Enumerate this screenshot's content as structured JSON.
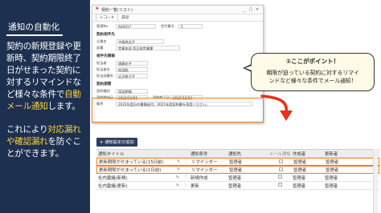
{
  "left_panel": {
    "title": "通知の自動化",
    "p1_lines": [
      {
        "parts": [
          {
            "text": "契約の新規登録や更",
            "hl": false
          }
        ]
      },
      {
        "parts": [
          {
            "text": "新時、契約期限終了",
            "hl": false
          }
        ]
      },
      {
        "parts": [
          {
            "text": "日がせまった契約に",
            "hl": false
          }
        ]
      },
      {
        "parts": [
          {
            "text": "対するリマインドな",
            "hl": false
          }
        ]
      },
      {
        "parts": [
          {
            "text": "ど様々な条件で",
            "hl": false
          },
          {
            "text": "自動",
            "hl": true
          }
        ]
      },
      {
        "parts": [
          {
            "text": "メール通知",
            "hl": true
          },
          {
            "text": "します。",
            "hl": false
          }
        ]
      }
    ],
    "p2_lines": [
      {
        "parts": [
          {
            "text": "これにより",
            "hl": false
          },
          {
            "text": "対応漏れ",
            "hl": true
          }
        ]
      },
      {
        "parts": [
          {
            "text": "や確認漏れ",
            "hl": true
          },
          {
            "text": "を防ぐこ",
            "hl": false
          }
        ]
      },
      {
        "parts": [
          {
            "text": "とができます。",
            "hl": false
          }
        ]
      }
    ],
    "highlight_color": "#ffd23c"
  },
  "record_window": {
    "title": "契約一覧(リスト)",
    "controls": [
      "_",
      "□",
      "×"
    ],
    "tabs": [
      "レコード",
      "履歴"
    ],
    "fields": {
      "mgmt_no_label": "管理No.",
      "mgmt_no": "A00017",
      "seq_label": "世代番号",
      "seq": "5",
      "party_head": "契約相手先",
      "company_label": "企業名",
      "company": "中尾商会子",
      "dept_label": "部署",
      "dept": "営業本部 西日本営業課",
      "contact_head": "相手先情報",
      "person_label": "担当者",
      "person": "遠藤花子",
      "mail_label": "担当者名",
      "mail": "松田聡",
      "tel_label": "担当部署名",
      "tel": "広沢修さ子",
      "period_head": "契約期間",
      "end_label": "契約種別",
      "end": "再延期間",
      "start_date_label": "契約開始日",
      "start_date": "2022/11/01",
      "end_date_label": "契約終了日",
      "end_date": "2022/12/03",
      "note_label": "備考",
      "note": "2022年度分の書類送付。2021年度契約書を再度ください。"
    }
  },
  "callout": {
    "title": "①ここがポイント！",
    "body_lines": [
      "期限が迫っている契約に対するリマイ",
      "ンドなど様々な条件でメール通知！"
    ]
  },
  "notifications": {
    "add_button": "通知設定の追加",
    "columns": [
      "通知タイトル",
      "",
      "",
      "通知条件",
      "通知先",
      "メール通知",
      "作成者",
      "更新者"
    ],
    "rows": [
      {
        "title": "更新期限がせまっている(15日前)",
        "cond": "リマインダー",
        "target": "管理者",
        "creator": "管理者",
        "updater": "管理者",
        "highlight": true
      },
      {
        "title": "更新期限がせまっている(1日前)",
        "cond": "リマインダー",
        "target": "管理者",
        "creator": "管理者",
        "updater": "管理者",
        "highlight": true
      },
      {
        "title": "社内稟議(新規)",
        "cond": "新規作成",
        "target": "管理者",
        "creator": "管理者",
        "updater": "管理者",
        "highlight": false
      },
      {
        "title": "社内稟議(更新)",
        "cond": "更新",
        "target": "管理者",
        "creator": "管理者",
        "updater": "管理者",
        "highlight": false
      }
    ]
  },
  "colors": {
    "navy": "#1e3050",
    "orange": "#f07f1a",
    "callout_bg": "#fffbe8"
  }
}
